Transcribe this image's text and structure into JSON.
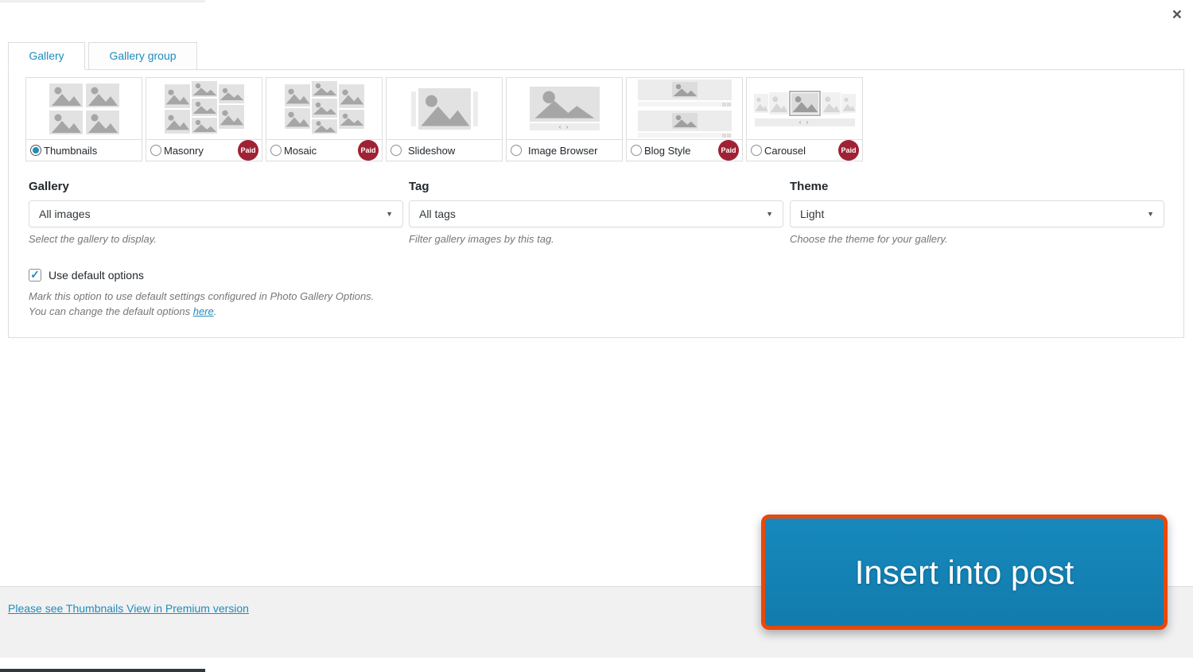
{
  "dialog": {
    "close_icon": "×",
    "tabs": [
      {
        "label": "Gallery",
        "active": true
      },
      {
        "label": "Gallery group",
        "active": false
      }
    ],
    "paid_badge_label": "Paid",
    "gallery_types": [
      {
        "label": "Thumbnails",
        "selected": true,
        "paid": false
      },
      {
        "label": "Masonry",
        "selected": false,
        "paid": true
      },
      {
        "label": "Mosaic",
        "selected": false,
        "paid": true
      },
      {
        "label": "Slideshow",
        "selected": false,
        "paid": false
      },
      {
        "label": "Image Browser",
        "selected": false,
        "paid": false
      },
      {
        "label": "Blog Style",
        "selected": false,
        "paid": true
      },
      {
        "label": "Carousel",
        "selected": false,
        "paid": true
      }
    ],
    "fields": [
      {
        "label": "Gallery",
        "value": "All images",
        "help": "Select the gallery to display."
      },
      {
        "label": "Tag",
        "value": "All tags",
        "help": "Filter gallery images by this tag."
      },
      {
        "label": "Theme",
        "value": "Light",
        "help": "Choose the theme for your gallery."
      }
    ],
    "default_options": {
      "label": "Use default options",
      "checked": true,
      "check_glyph": "✓",
      "help_line1": "Mark this option to use default settings configured in Photo Gallery Options.",
      "help_line2_prefix": "You can change the default options ",
      "help_link": "here",
      "help_suffix": "."
    },
    "footer": {
      "premium_link": "Please see Thumbnails View in Premium version"
    },
    "insert_button": {
      "label": "Insert into post"
    },
    "select_caret": "▼",
    "nav_glyph": "‹ ›"
  },
  "colors": {
    "accent_blue": "#1e8cbe",
    "paid_red": "#9e2233",
    "button_blue": "#147bad",
    "button_border_orange": "#e8480b",
    "border_gray": "#dddddd",
    "footer_gray": "#f1f1f1"
  }
}
